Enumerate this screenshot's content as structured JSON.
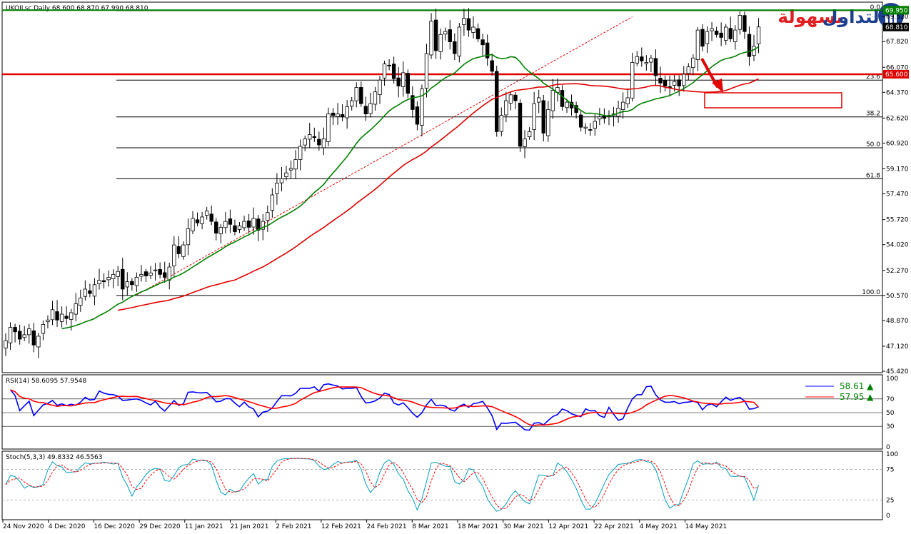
{
  "header": {
    "symbol_info": "UKOILsc,Daily  68.600 68.870 67.990 68.810"
  },
  "logo": {
    "word1": "التداول",
    "word2": "بسهولة",
    "word1_color": "#1d3f8f",
    "word2_color": "#e02020"
  },
  "colors": {
    "bull": "#ffffff",
    "bear": "#000000",
    "ma_fast": "#008000",
    "ma_slow": "#e00000",
    "rsi": "#0000ff",
    "rsi_signal": "#ff0000",
    "stoch_main": "#00a0c0",
    "stoch_signal": "#ff0000",
    "grid_level": "#000000",
    "hline_green": "#008000",
    "hline_red": "#e00000",
    "arrow": "#e00000"
  },
  "chart_data": [
    {
      "type": "candlestick",
      "title": "UKOILsc,Daily",
      "ohlc_last": {
        "open": 68.6,
        "high": 68.87,
        "low": 67.99,
        "close": 68.81
      },
      "y_ticks": [
        "69.920",
        "69.520",
        "67.820",
        "66.070",
        "64.370",
        "62.620",
        "60.920",
        "59.170",
        "57.470",
        "55.720",
        "54.020",
        "52.270",
        "50.570",
        "48.870",
        "47.120",
        "45.420"
      ],
      "ylim": [
        45.42,
        70.4
      ],
      "x_ticks": [
        "24 Nov 2020",
        "4 Dec 2020",
        "16 Dec 2020",
        "29 Dec 2020",
        "11 Jan 2021",
        "21 Jan 2021",
        "2 Feb 2021",
        "12 Feb 2021",
        "24 Feb 2021",
        "8 Mar 2021",
        "18 Mar 2021",
        "30 Mar 2021",
        "12 Apr 2021",
        "22 Apr 2021",
        "4 May 2021",
        "14 May 2021"
      ],
      "fib_levels": [
        {
          "label": "0.0",
          "value": 69.92
        },
        {
          "label": "23.6",
          "value": 65.2
        },
        {
          "label": "38.2",
          "value": 62.7
        },
        {
          "label": "50.0",
          "value": 60.6
        },
        {
          "label": "61.8",
          "value": 58.5
        },
        {
          "label": "100.0",
          "value": 50.57
        }
      ],
      "price_labels": [
        {
          "text": "69.950",
          "value": 69.95,
          "color": "#008000"
        },
        {
          "text": "68.810",
          "value": 68.81,
          "color": "#000000"
        },
        {
          "text": "65.600",
          "value": 65.6,
          "color": "#e00000"
        }
      ],
      "closes": [
        47.5,
        48.4,
        48.1,
        47.6,
        47.9,
        48.3,
        47.2,
        47.8,
        48.6,
        48.9,
        49.6,
        48.9,
        49.3,
        49.0,
        49.4,
        50.0,
        50.4,
        51.0,
        50.7,
        51.3,
        51.6,
        51.5,
        51.8,
        52.0,
        52.2,
        51.0,
        51.5,
        51.3,
        51.8,
        52.0,
        51.9,
        52.1,
        52.3,
        52.0,
        51.8,
        52.5,
        54.0,
        53.4,
        54.0,
        55.1,
        55.8,
        55.5,
        55.9,
        56.3,
        55.6,
        54.8,
        55.2,
        55.6,
        55.4,
        54.9,
        55.3,
        55.6,
        55.2,
        55.8,
        55.0,
        55.6,
        56.2,
        57.4,
        58.2,
        58.5,
        58.9,
        59.2,
        59.8,
        60.7,
        61.2,
        61.5,
        61.3,
        60.8,
        61.2,
        62.9,
        62.8,
        62.9,
        62.7,
        63.4,
        63.8,
        64.7,
        63.6,
        62.9,
        63.6,
        64.4,
        65.2,
        66.3,
        66.2,
        65.3,
        64.8,
        65.7,
        64.3,
        63.2,
        62.2,
        64.6,
        67.0,
        69.2,
        67.2,
        68.3,
        68.5,
        67.8,
        67.0,
        68.8,
        69.4,
        68.6,
        68.8,
        68.0,
        67.6,
        66.7,
        65.8,
        61.7,
        62.8,
        63.8,
        64.2,
        63.8,
        60.7,
        61.2,
        61.7,
        63.6,
        64.0,
        61.6,
        63.2,
        64.5,
        64.7,
        63.4,
        63.7,
        63.3,
        63.0,
        62.0,
        62.0,
        61.8,
        62.4,
        62.7,
        62.6,
        62.8,
        62.9,
        63.3,
        63.7,
        64.0,
        66.4,
        66.8,
        66.5,
        66.4,
        66.7,
        65.5,
        65.0,
        64.8,
        64.7,
        65.1,
        64.8,
        65.6,
        66.1,
        66.7,
        68.6,
        67.5,
        68.5,
        68.7,
        68.3,
        68.1,
        68.8,
        68.0,
        68.6,
        69.6,
        68.5,
        66.8,
        67.5,
        68.81
      ],
      "indicators": [
        "MA fast (green)",
        "MA slow (red)"
      ]
    },
    {
      "type": "line",
      "title": "RSI(14) 58.6095 57.9548",
      "series": [
        {
          "name": "RSI(14)",
          "last": 58.61
        },
        {
          "name": "Signal",
          "last": 57.95
        }
      ],
      "y_ticks": [
        "100",
        "70",
        "50",
        "30",
        "0"
      ],
      "ylim": [
        0,
        100
      ]
    },
    {
      "type": "line",
      "title": "Stoch(5,3,3) 49.8332 46.5563",
      "series": [
        {
          "name": "%K",
          "last": 49.8332
        },
        {
          "name": "%D",
          "last": 46.5563
        }
      ],
      "y_ticks": [
        "100",
        "75",
        "25",
        "0"
      ],
      "ylim": [
        0,
        100
      ]
    }
  ],
  "rsi_badges": [
    {
      "text": "58.61 ▲",
      "color": "#008000"
    },
    {
      "text": "57.95 ▲",
      "color": "#008000"
    }
  ]
}
